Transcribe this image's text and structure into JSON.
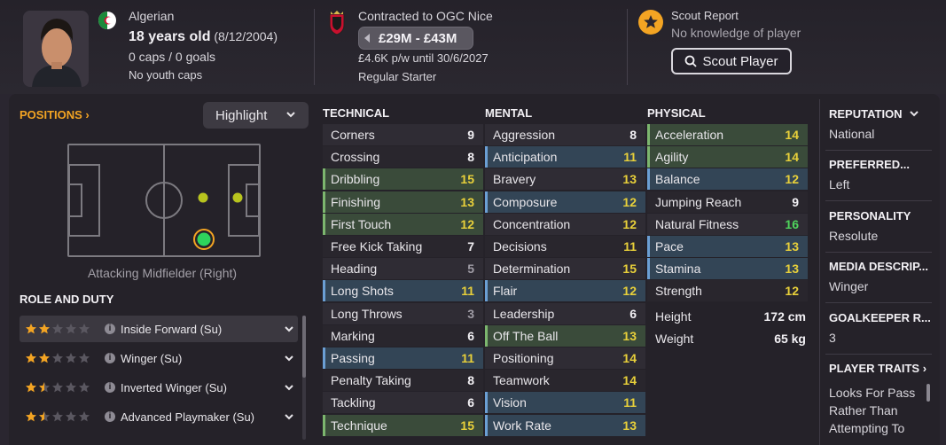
{
  "header": {
    "nationality": "Algerian",
    "age": "18 years old",
    "dob": "(8/12/2004)",
    "caps": "0 caps / 0 goals",
    "youth_caps": "No youth caps",
    "contract": "Contracted to OGC Nice",
    "value": "£29M - £43M",
    "wage": "£4.6K p/w until 30/6/2027",
    "squad_status": "Regular Starter",
    "scout_title": "Scout Report",
    "scout_knowledge": "No knowledge of player",
    "scout_button": "Scout Player",
    "accent": "#f3a423"
  },
  "positions": {
    "title": "POSITIONS",
    "dropdown": "Highlight",
    "caption": "Attacking Midfielder (Right)"
  },
  "roles": {
    "title": "ROLE AND DUTY",
    "items": [
      {
        "label": "Inside Forward (Su)",
        "stars": 2
      },
      {
        "label": "Winger (Su)",
        "stars": 2
      },
      {
        "label": "Inverted Winger (Su)",
        "stars": 1.5
      },
      {
        "label": "Advanced Playmaker (Su)",
        "stars": 1.5
      }
    ]
  },
  "technical": {
    "title": "TECHNICAL",
    "rows": [
      {
        "name": "Corners",
        "value": "9",
        "hl": ""
      },
      {
        "name": "Crossing",
        "value": "8",
        "hl": ""
      },
      {
        "name": "Dribbling",
        "value": "15",
        "hl": "green"
      },
      {
        "name": "Finishing",
        "value": "13",
        "hl": "green"
      },
      {
        "name": "First Touch",
        "value": "12",
        "hl": "green"
      },
      {
        "name": "Free Kick Taking",
        "value": "7",
        "hl": ""
      },
      {
        "name": "Heading",
        "value": "5",
        "hl": ""
      },
      {
        "name": "Long Shots",
        "value": "11",
        "hl": "blue"
      },
      {
        "name": "Long Throws",
        "value": "3",
        "hl": ""
      },
      {
        "name": "Marking",
        "value": "6",
        "hl": ""
      },
      {
        "name": "Passing",
        "value": "11",
        "hl": "blue"
      },
      {
        "name": "Penalty Taking",
        "value": "8",
        "hl": ""
      },
      {
        "name": "Tackling",
        "value": "6",
        "hl": ""
      },
      {
        "name": "Technique",
        "value": "15",
        "hl": "green"
      }
    ]
  },
  "mental": {
    "title": "MENTAL",
    "rows": [
      {
        "name": "Aggression",
        "value": "8",
        "hl": ""
      },
      {
        "name": "Anticipation",
        "value": "11",
        "hl": "blue"
      },
      {
        "name": "Bravery",
        "value": "13",
        "hl": ""
      },
      {
        "name": "Composure",
        "value": "12",
        "hl": "blue"
      },
      {
        "name": "Concentration",
        "value": "12",
        "hl": ""
      },
      {
        "name": "Decisions",
        "value": "11",
        "hl": ""
      },
      {
        "name": "Determination",
        "value": "15",
        "hl": ""
      },
      {
        "name": "Flair",
        "value": "12",
        "hl": "blue"
      },
      {
        "name": "Leadership",
        "value": "6",
        "hl": ""
      },
      {
        "name": "Off The Ball",
        "value": "13",
        "hl": "green"
      },
      {
        "name": "Positioning",
        "value": "14",
        "hl": ""
      },
      {
        "name": "Teamwork",
        "value": "14",
        "hl": ""
      },
      {
        "name": "Vision",
        "value": "11",
        "hl": "blue"
      },
      {
        "name": "Work Rate",
        "value": "13",
        "hl": "blue"
      }
    ]
  },
  "physical": {
    "title": "PHYSICAL",
    "rows": [
      {
        "name": "Acceleration",
        "value": "14",
        "hl": "green"
      },
      {
        "name": "Agility",
        "value": "14",
        "hl": "green"
      },
      {
        "name": "Balance",
        "value": "12",
        "hl": "blue"
      },
      {
        "name": "Jumping Reach",
        "value": "9",
        "hl": ""
      },
      {
        "name": "Natural Fitness",
        "value": "16",
        "hl": ""
      },
      {
        "name": "Pace",
        "value": "13",
        "hl": "blue"
      },
      {
        "name": "Stamina",
        "value": "13",
        "hl": "blue"
      },
      {
        "name": "Strength",
        "value": "12",
        "hl": ""
      }
    ],
    "height_label": "Height",
    "height_value": "172 cm",
    "weight_label": "Weight",
    "weight_value": "65 kg"
  },
  "info": {
    "reputation_label": "REPUTATION",
    "reputation_value": "National",
    "foot_label": "PREFERRED...",
    "foot_value": "Left",
    "personality_label": "PERSONALITY",
    "personality_value": "Resolute",
    "media_label": "MEDIA DESCRIP...",
    "media_value": "Winger",
    "gk_label": "GOALKEEPER R...",
    "gk_value": "3",
    "traits_label": "PLAYER TRAITS",
    "traits_value": "Looks For Pass Rather Than Attempting To"
  }
}
